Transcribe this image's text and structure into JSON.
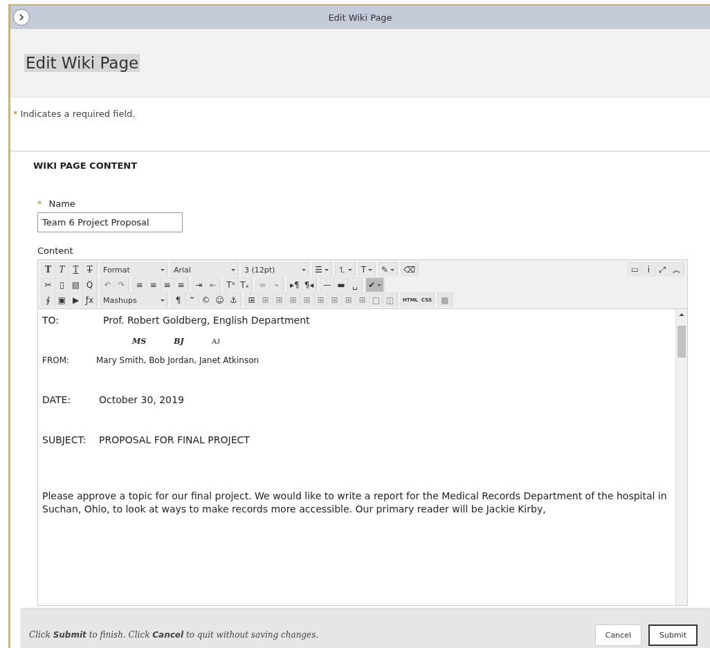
{
  "window": {
    "title": "Edit Wiki Page"
  },
  "page_title": "Edit Wiki Page",
  "required_note": {
    "mark": "*",
    "text": "Indicates a required field."
  },
  "section": {
    "title": "WIKI PAGE CONTENT"
  },
  "name_field": {
    "mark": "*",
    "label": "Name",
    "value": "Team 6 Project Proposal"
  },
  "content_label": "Content",
  "toolbar": {
    "rows": [
      {
        "groups": [
          [
            {
              "glyph": "T",
              "kind": "bold",
              "disabled": false,
              "on": false
            },
            {
              "glyph": "T",
              "kind": "italic",
              "disabled": false,
              "on": false
            },
            {
              "glyph": "T",
              "kind": "underline",
              "disabled": false,
              "on": false
            },
            {
              "glyph": "T",
              "kind": "strike",
              "disabled": false,
              "on": false
            }
          ],
          [
            {
              "kind": "select",
              "label": "Format",
              "disabled": false,
              "on": false
            }
          ],
          [
            {
              "kind": "select",
              "label": "Arial",
              "disabled": false,
              "on": false
            }
          ],
          [
            {
              "kind": "select",
              "label": "3 (12pt)",
              "disabled": false,
              "on": false
            }
          ],
          [
            {
              "kind": "split",
              "glyph": "☰",
              "disabled": false,
              "on": false
            }
          ],
          [
            {
              "kind": "split",
              "glyph": "⒈",
              "disabled": false,
              "on": false
            }
          ],
          [
            {
              "kind": "split",
              "glyph": "T",
              "disabled": false,
              "on": false
            }
          ],
          [
            {
              "kind": "split",
              "glyph": "✎",
              "disabled": false,
              "on": false
            }
          ],
          [
            {
              "glyph": "⌫",
              "disabled": false,
              "on": false
            }
          ],
          [
            {
              "kind": "spacer"
            }
          ],
          [
            {
              "glyph": "▭",
              "disabled": false,
              "on": false
            },
            {
              "glyph": "i",
              "disabled": false,
              "on": false
            },
            {
              "glyph": "⤢",
              "disabled": false,
              "on": false
            },
            {
              "glyph": "︽",
              "disabled": false,
              "on": false
            }
          ]
        ]
      },
      {
        "groups": [
          [
            {
              "glyph": "✂",
              "disabled": false,
              "on": false
            },
            {
              "glyph": "▯",
              "disabled": false,
              "on": false
            },
            {
              "glyph": "▤",
              "disabled": false,
              "on": false
            },
            {
              "glyph": "Q",
              "disabled": false,
              "on": false
            }
          ],
          [
            {
              "glyph": "↶",
              "disabled": true,
              "on": false
            },
            {
              "glyph": "↷",
              "disabled": true,
              "on": false
            }
          ],
          [
            {
              "glyph": "≡",
              "disabled": false,
              "on": false
            },
            {
              "glyph": "≡",
              "disabled": false,
              "on": false
            },
            {
              "glyph": "≡",
              "disabled": false,
              "on": false
            },
            {
              "glyph": "≡",
              "disabled": false,
              "on": false
            }
          ],
          [
            {
              "glyph": "⇥",
              "disabled": false,
              "on": false
            },
            {
              "glyph": "⇤",
              "disabled": true,
              "on": false
            }
          ],
          [
            {
              "glyph": "Tˣ",
              "disabled": false,
              "on": false
            },
            {
              "glyph": "Tₓ",
              "disabled": false,
              "on": false
            }
          ],
          [
            {
              "glyph": "∞",
              "disabled": true,
              "on": false
            },
            {
              "glyph": "⌁",
              "disabled": true,
              "on": false
            }
          ],
          [
            {
              "glyph": "▸¶",
              "disabled": false,
              "on": false
            },
            {
              "glyph": "¶◂",
              "disabled": false,
              "on": false
            }
          ],
          [
            {
              "glyph": "—",
              "disabled": false,
              "on": false
            },
            {
              "glyph": "▬",
              "disabled": false,
              "on": false
            },
            {
              "glyph": "␣",
              "disabled": false,
              "on": false
            }
          ],
          [
            {
              "kind": "split",
              "glyph": "✔",
              "disabled": false,
              "on": true
            }
          ]
        ]
      },
      {
        "groups": [
          [
            {
              "glyph": "∮",
              "disabled": false,
              "on": false
            },
            {
              "glyph": "▣",
              "disabled": false,
              "on": false
            },
            {
              "glyph": "▶",
              "disabled": false,
              "on": false
            },
            {
              "glyph": "ƒx",
              "disabled": false,
              "on": false
            }
          ],
          [
            {
              "kind": "select",
              "label": "Mashups",
              "disabled": false,
              "on": false
            }
          ],
          [
            {
              "glyph": "¶",
              "disabled": false,
              "on": false
            },
            {
              "glyph": "“",
              "disabled": false,
              "on": false
            },
            {
              "glyph": "©",
              "disabled": false,
              "on": false
            },
            {
              "glyph": "☺",
              "disabled": false,
              "on": false
            },
            {
              "glyph": "⚓",
              "disabled": false,
              "on": false
            }
          ],
          [
            {
              "glyph": "⊞",
              "disabled": false,
              "on": false
            },
            {
              "glyph": "⊞",
              "disabled": true,
              "on": false
            },
            {
              "glyph": "⊞",
              "disabled": true,
              "on": false
            },
            {
              "glyph": "⊞",
              "disabled": true,
              "on": false
            },
            {
              "glyph": "⊞",
              "disabled": true,
              "on": false
            },
            {
              "glyph": "⊞",
              "disabled": true,
              "on": false
            },
            {
              "glyph": "⊞",
              "disabled": true,
              "on": false
            },
            {
              "glyph": "⊞",
              "disabled": true,
              "on": false
            },
            {
              "glyph": "⊞",
              "disabled": true,
              "on": false
            },
            {
              "glyph": "□",
              "disabled": true,
              "on": false
            },
            {
              "glyph": "◫",
              "disabled": true,
              "on": false
            }
          ],
          [
            {
              "glyph": "HTML",
              "disabled": false,
              "on": false
            },
            {
              "glyph": "CSS",
              "disabled": false,
              "on": false
            }
          ],
          [
            {
              "glyph": "▦",
              "disabled": true,
              "on": false
            }
          ]
        ]
      }
    ]
  },
  "document": [
    {
      "kind": "memo",
      "label": "TO:",
      "text": "Prof. Robert Goldberg, English Department",
      "small": false
    },
    {
      "kind": "initials",
      "items": [
        "MS",
        "BJ",
        "AJ"
      ]
    },
    {
      "kind": "memo",
      "label": "FROM:",
      "text": "Mary Smith, Bob Jordan, Janet Atkinson",
      "small": true
    },
    {
      "kind": "memo",
      "label": "DATE:",
      "text": "October 30, 2019",
      "small": false
    },
    {
      "kind": "memo",
      "label": "SUBJECT:",
      "text": "PROPOSAL FOR FINAL PROJECT",
      "small": false
    },
    {
      "kind": "paragraph",
      "text": "Please approve a topic for our final project. We would like to write a report for the Medical Records Department of the hospital in Suchan, Ohio, to look at ways to make records more accessible. Our primary reader will be Jackie Kirby,"
    }
  ],
  "footer": {
    "hint": "Click **Submit** to finish. Click **Cancel** to quit without saving changes.",
    "buttons": [
      "Cancel",
      "Submit"
    ]
  }
}
